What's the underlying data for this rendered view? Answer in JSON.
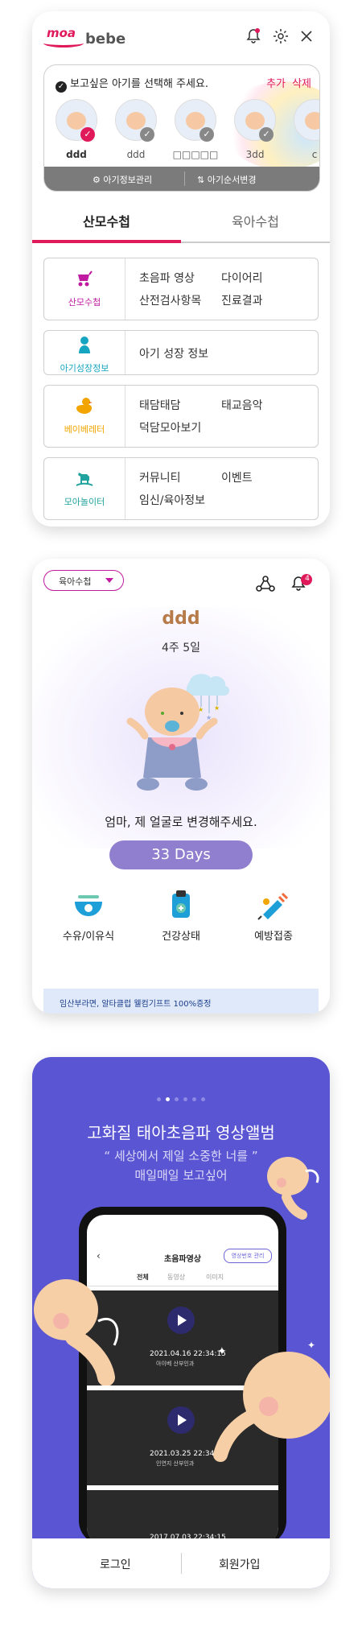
{
  "app": {
    "logo_top": "moa",
    "logo_bottom": "bebe"
  },
  "child_select": {
    "title": "보고싶은 아기를 선택해 주세요.",
    "add_label": "추가",
    "delete_label": "삭제",
    "children": [
      {
        "name": "ddd",
        "selected": true
      },
      {
        "name": "ddd",
        "selected": false
      },
      {
        "name": "□□□□□",
        "selected": false
      },
      {
        "name": "3dd",
        "selected": false
      },
      {
        "name": "c",
        "selected": false
      }
    ],
    "footer_info": "아기정보관리",
    "footer_order": "아기순서변경"
  },
  "tabs": {
    "active": "산모수첩",
    "inactive": "육아수첩"
  },
  "menus": [
    {
      "label": "산모수첩",
      "color": "#c01aa0",
      "links": [
        "초음파 영상",
        "다이어리",
        "산전검사항목",
        "진료결과"
      ]
    },
    {
      "label": "아기성장정보",
      "color": "#16a5c0",
      "links": [
        "아기 성장 정보"
      ]
    },
    {
      "label": "베이베레터",
      "color": "#f2a500",
      "links": [
        "태담태담",
        "태교음악",
        "덕담모아보기"
      ]
    },
    {
      "label": "모아놀이터",
      "color": "#20a39e",
      "links": [
        "커뮤니티",
        "이벤트",
        "임신/육아정보"
      ]
    }
  ],
  "card2": {
    "dropdown_label": "육아수첩",
    "notification_count": "4",
    "baby_name": "ddd",
    "baby_age": "4주 5일",
    "prompt": "엄마, 제 얼굴로 변경해주세요.",
    "days_label": "33 Days",
    "features": [
      "수유/이유식",
      "건강상태",
      "예방접종"
    ],
    "banner_text": "임산부라면, 알타클럽 웰컴기프트 100%증정"
  },
  "card3": {
    "title": "고화질 태아초음파 영상앨범",
    "quote_line1": "세상에서 제일 소중한 너를",
    "quote_line2": "매일매일 보고싶어",
    "screen_title": "초음파영상",
    "screen_button": "영상번호 관리",
    "screen_tabs": [
      "전체",
      "동영상",
      "이미지"
    ],
    "videos": [
      {
        "date": "2021.04.16  22:34:15",
        "hospital": "아이베 산부인과"
      },
      {
        "date": "2021.03.25  22:34:15",
        "hospital": "인연지 산부인과"
      },
      {
        "date": "2017.07.03  22:34:15",
        "hospital": ""
      }
    ],
    "login_label": "로그인",
    "signup_label": "회원가입"
  }
}
